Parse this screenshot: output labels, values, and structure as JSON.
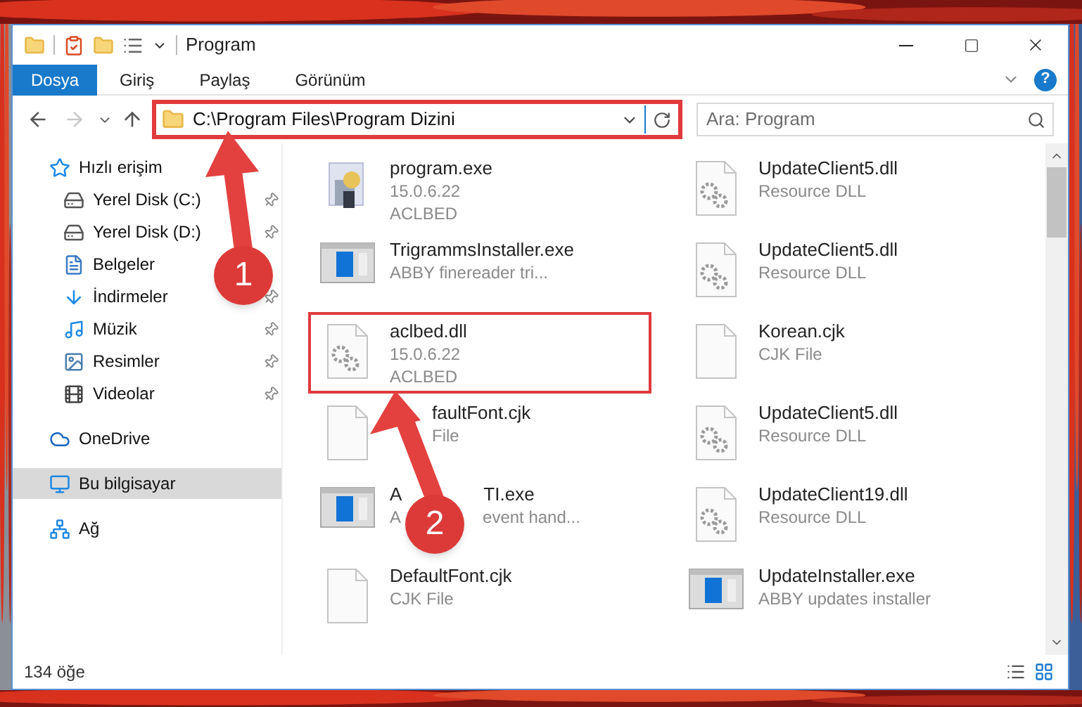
{
  "window": {
    "title": "Program",
    "controls": [
      {
        "kind": "minimize"
      },
      {
        "kind": "maximize"
      },
      {
        "kind": "close"
      }
    ]
  },
  "ribbon": {
    "tabs": [
      {
        "label": "Dosya",
        "kind": "file"
      },
      {
        "label": "Giriş",
        "kind": "tab"
      },
      {
        "label": "Paylaş",
        "kind": "tab"
      },
      {
        "label": "Görünüm",
        "kind": "tab"
      }
    ],
    "help": "?"
  },
  "address": {
    "path": "C:\\Program Files\\Program Dizini",
    "highlighted": true,
    "forward_disabled": true
  },
  "search": {
    "placeholder": "Ara: Program"
  },
  "sidebar": {
    "items": [
      {
        "label": "Hızlı erişim",
        "selected": false,
        "children": [
          {
            "label": "Yerel Disk (C:)",
            "pinned": true,
            "selected": false
          },
          {
            "label": "Yerel Disk (D:)",
            "pinned": true,
            "selected": false
          },
          {
            "label": "Belgeler",
            "selected": false
          },
          {
            "label": "İndirmeler",
            "pinned": true,
            "selected": false
          },
          {
            "label": "Müzik",
            "pinned": true,
            "selected": false
          },
          {
            "label": "Resimler",
            "pinned": true,
            "selected": false
          },
          {
            "label": "Videolar",
            "pinned": true,
            "selected": false
          }
        ]
      },
      {
        "label": "OneDrive",
        "selected": false
      },
      {
        "label": "Bu bilgisayar",
        "selected": true
      },
      {
        "label": "Ağ",
        "selected": false
      }
    ]
  },
  "files": [
    {
      "kind": "app",
      "highlighted": false,
      "lines": [
        [
          "program.exe"
        ],
        [
          "15.0.6.22"
        ],
        [
          "ACLBED"
        ]
      ]
    },
    {
      "kind": "dll",
      "highlighted": false,
      "lines": [
        [
          "UpdateClient5.dll"
        ],
        [
          "Resource DLL"
        ]
      ]
    },
    {
      "kind": "installer",
      "highlighted": false,
      "lines": [
        [
          "TrigrammsInstaller.exe"
        ],
        [
          "ABBY finereader tri..."
        ]
      ]
    },
    {
      "kind": "dll",
      "highlighted": false,
      "lines": [
        [
          "UpdateClient5.dll"
        ],
        [
          "Resource DLL"
        ]
      ]
    },
    {
      "kind": "dll",
      "highlighted": true,
      "lines": [
        [
          "aclbed.dll"
        ],
        [
          "15.0.6.22"
        ],
        [
          "ACLBED"
        ]
      ]
    },
    {
      "kind": "blank",
      "highlighted": false,
      "lines": [
        [
          "Korean.cjk"
        ],
        [
          "CJK File"
        ]
      ]
    },
    {
      "kind": "blank",
      "highlighted": false,
      "partly_covered": true,
      "lines": [
        [
          "faultFont.cjk"
        ],
        [
          "File"
        ]
      ]
    },
    {
      "kind": "dll",
      "highlighted": false,
      "lines": [
        [
          "UpdateClient5.dll"
        ],
        [
          "Resource DLL"
        ]
      ]
    },
    {
      "kind": "installer",
      "highlighted": false,
      "lines": [
        [
          "A",
          "TI.exe"
        ],
        [
          "A",
          "event hand..."
        ]
      ]
    },
    {
      "kind": "dll",
      "highlighted": false,
      "lines": [
        [
          "UpdateClient19.dll"
        ],
        [
          "Resource DLL"
        ]
      ]
    },
    {
      "kind": "blank",
      "highlighted": false,
      "lines": [
        [
          "DefaultFont.cjk"
        ],
        [
          "CJK File"
        ]
      ]
    },
    {
      "kind": "installer",
      "highlighted": false,
      "lines": [
        [
          "UpdateInstaller.exe"
        ],
        [
          "ABBY updates installer"
        ]
      ]
    }
  ],
  "status_bar": {
    "count": "134 öğe"
  },
  "annotations": [
    {
      "number": "1"
    },
    {
      "number": "2"
    }
  ]
}
